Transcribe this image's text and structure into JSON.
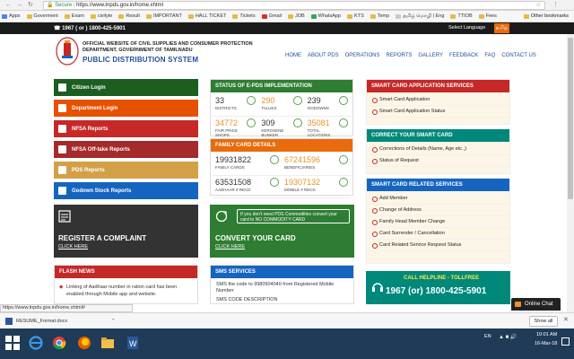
{
  "browser": {
    "security_label": "Secure",
    "url": "https://www.tnpds.gov.in/home.xhtml",
    "status_url": "https://www.tnpds.gov.in/home.xhtml#",
    "bookmarks": [
      {
        "label": "Apps",
        "icon": "app"
      },
      {
        "label": "Goverment",
        "icon": "folder"
      },
      {
        "label": "Exam",
        "icon": "folder"
      },
      {
        "label": "civilyte",
        "icon": "folder"
      },
      {
        "label": "Result",
        "icon": "folder"
      },
      {
        "label": "IMPORTANT",
        "icon": "folder"
      },
      {
        "label": "HALL TICKET",
        "icon": "folder"
      },
      {
        "label": "Tickets",
        "icon": "folder"
      },
      {
        "label": "Gmail",
        "icon": "red"
      },
      {
        "label": "JOB",
        "icon": "folder"
      },
      {
        "label": "WhatsApp",
        "icon": "green"
      },
      {
        "label": "KTS",
        "icon": "folder"
      },
      {
        "label": "Temp",
        "icon": "folder"
      },
      {
        "label": "தமிழ் மொழி | Eng",
        "icon": "page"
      },
      {
        "label": "TTIOB",
        "icon": "folder"
      },
      {
        "label": "Fees",
        "icon": "folder"
      }
    ],
    "other_bookmarks": "Other bookmarks"
  },
  "topbar": {
    "helpline": "1967 ( or ) 1800-425-5901",
    "select_language": "Select Language",
    "tamil": "தமிழ்"
  },
  "header": {
    "org_line1": "OFFICIAL WEBSITE OF CIVIL SUPPLIES AND CONSUMER PROTECTION",
    "org_line2": "DEPARTMENT, GOVERNMENT OF TAMILNADU",
    "logo_text": "PUBLIC DISTRIBUTION SYSTEM",
    "nav": [
      "HOME",
      "ABOUT PDS",
      "OPERATIONS",
      "REPORTS",
      "GALLERY",
      "FEEDBACK",
      "FAQ",
      "CONTACT US"
    ]
  },
  "left_menu": [
    {
      "label": "Citizen Login",
      "color": "#1b5e20"
    },
    {
      "label": "Department Login",
      "color": "#e65100"
    },
    {
      "label": "NFSA Reports",
      "color": "#c62828"
    },
    {
      "label": "NFSA Off-take Reports",
      "color": "#a52a2a"
    },
    {
      "label": "PDS Reports",
      "color": "#d4a047"
    },
    {
      "label": "Godown Stock Reports",
      "color": "#1565c0"
    }
  ],
  "register": {
    "title": "REGISTER A COMPLAINT",
    "link": "CLICK HERE"
  },
  "flash": {
    "title": "FLASH NEWS",
    "item": "Linking of Aadhaar number in ration card has been enabled through Mobile app and website."
  },
  "epds": {
    "title": "STATUS OF E-PDS IMPLEMENTATION",
    "stats": [
      {
        "num": "33",
        "label": "DISTRICTS",
        "orange": false
      },
      {
        "num": "290",
        "label": "TALUKS",
        "orange": true
      },
      {
        "num": "239",
        "label": "GODOWNS",
        "orange": false
      },
      {
        "num": "34772",
        "label": "FAIR PRICE SHOPS",
        "orange": true
      },
      {
        "num": "309",
        "label": "KEROSENE BUNKER",
        "orange": false
      },
      {
        "num": "35081",
        "label": "TOTAL LOCATIONS",
        "orange": true
      }
    ]
  },
  "family": {
    "title": "FAMILY CARD DETAILS",
    "stats": [
      {
        "num": "19931822",
        "label": "FAMILY CARDS",
        "orange": false
      },
      {
        "num": "67241596",
        "label": "BENEFICIARIES",
        "orange": true
      },
      {
        "num": "63531508",
        "label": "AADHAAR # RECD",
        "orange": false
      },
      {
        "num": "19307132",
        "label": "MOBILE # RECD",
        "orange": true
      }
    ]
  },
  "convert": {
    "note": "If you don't need PDS Commodities convert your card to NO COMMODITY CARD",
    "title": "CONVERT YOUR CARD",
    "link": "CLICK HERE"
  },
  "sms": {
    "title": "SMS SERVICES",
    "line1": "SMS the code to 9980904040 from Registered Mobile Number",
    "line2": "SMS CODE DESCRIPTION"
  },
  "smart_app": {
    "title": "SMART CARD APPLICATION SERVICES",
    "links": [
      "Smart Card Application",
      "Smart Card Application Status"
    ]
  },
  "correct": {
    "title": "CORRECT YOUR SMART CARD",
    "links": [
      "Corrections of Details (Name, Age etc.,)",
      "Status of Request"
    ]
  },
  "related": {
    "title": "SMART CARD RELATED SERVICES",
    "links": [
      "Add Member",
      "Change of Address",
      "Family Head Member Change",
      "Card Surrender / Cancellation",
      "Card Related Service Request Status"
    ]
  },
  "helpline_box": {
    "title": "CALL HELPLINE - TOLLFREE",
    "number": "1967 (or) 1800-425-5901"
  },
  "chat": "Online Chat",
  "download": {
    "file": "RESUME_Format.docx",
    "show_all": "Show all"
  },
  "taskbar": {
    "lang": "EN",
    "time": "10:01 AM",
    "date": "16-Mar-18"
  },
  "colors": {
    "green": "#2e7d32",
    "red": "#c62828",
    "teal": "#00897b",
    "blue": "#1565c0",
    "pds_blue": "#1e4e9c",
    "orange": "#e86b0c",
    "taskbar": "#1f3b57"
  }
}
